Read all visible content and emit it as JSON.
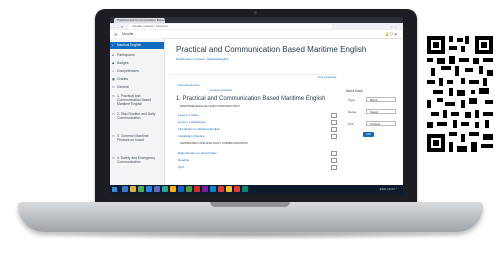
{
  "browser": {
    "tab_title": "Practical and Communication Based M...",
    "url": "moodle / course / view.php",
    "nav": "← → ⟳",
    "bookmarks": "☆ ⋮"
  },
  "topnav": {
    "menu_icon": "hamburger-icon",
    "site_name": "Moodle",
    "user": "🔔 💬 ◉"
  },
  "sidebar": {
    "items": [
      {
        "label": "Nautical English",
        "active": true
      },
      {
        "label": "Participants"
      },
      {
        "label": "Badges"
      },
      {
        "label": "Competencies"
      },
      {
        "label": "Grades"
      },
      {
        "label": "General"
      },
      {
        "label": "1. Practical and Communication Based Maritime English"
      },
      {
        "label": "2. Ship Routine and Daily Communication"
      },
      {
        "label": "3. Common Maritime Phrases on board"
      },
      {
        "label": "4. Safety and Emergency Communication"
      }
    ]
  },
  "main": {
    "course_title": "Practical and Communication Based Maritime English",
    "breadcrumb": "Dashboard / Courses / Nautical English",
    "progress_label": "Your progress",
    "general_activities": [
      "Announcements",
      "Course overview"
    ],
    "section_title": "1. Practical and Communication Based Maritime English",
    "subheading_1": "MARITIME ENGLISH AND INTRODUCTION",
    "list_1": [
      "Lesson 1 Video",
      "Lesson 1 Worksheet",
      "Introduction to Maritime English",
      "Vocabulary Practice"
    ],
    "subheading_2": "SHIPBOARD LIFE AND DAILY COMMUNICATION",
    "list_2": [
      "Daily Routine on board Video",
      "Reading",
      "Quiz"
    ]
  },
  "right_block": {
    "title": "Add a block",
    "rows": [
      {
        "label": "Type",
        "value": "Block"
      },
      {
        "label": "Name",
        "value": "Select"
      },
      {
        "label": "Link",
        "value": "Choose"
      }
    ],
    "button": "Add"
  },
  "taskbar": {
    "tray": "ENG  10:24  ⌃"
  },
  "colors": {
    "accent": "#0f6cbf",
    "taskbar": "#0c1a2e",
    "bezel": "#1b1d22"
  }
}
